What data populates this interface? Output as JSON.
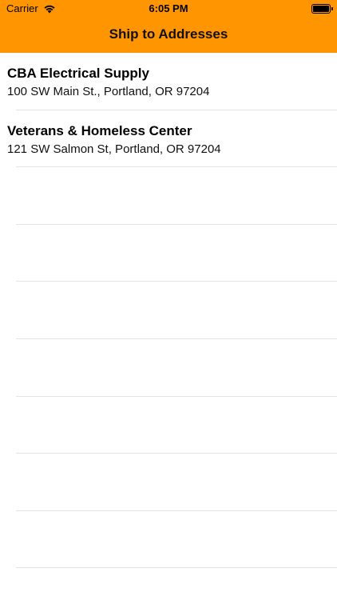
{
  "status_bar": {
    "carrier": "Carrier",
    "time": "6:05 PM",
    "wifi_icon": "wifi-icon",
    "battery_icon": "battery-icon"
  },
  "nav": {
    "title": "Ship to Addresses",
    "background_color": "#FF9500"
  },
  "addresses": [
    {
      "name": "CBA Electrical Supply",
      "address": "100 SW Main St., Portland, OR 97204"
    },
    {
      "name": "Veterans & Homeless Center",
      "address": "121 SW Salmon St, Portland, OR 97204"
    }
  ]
}
